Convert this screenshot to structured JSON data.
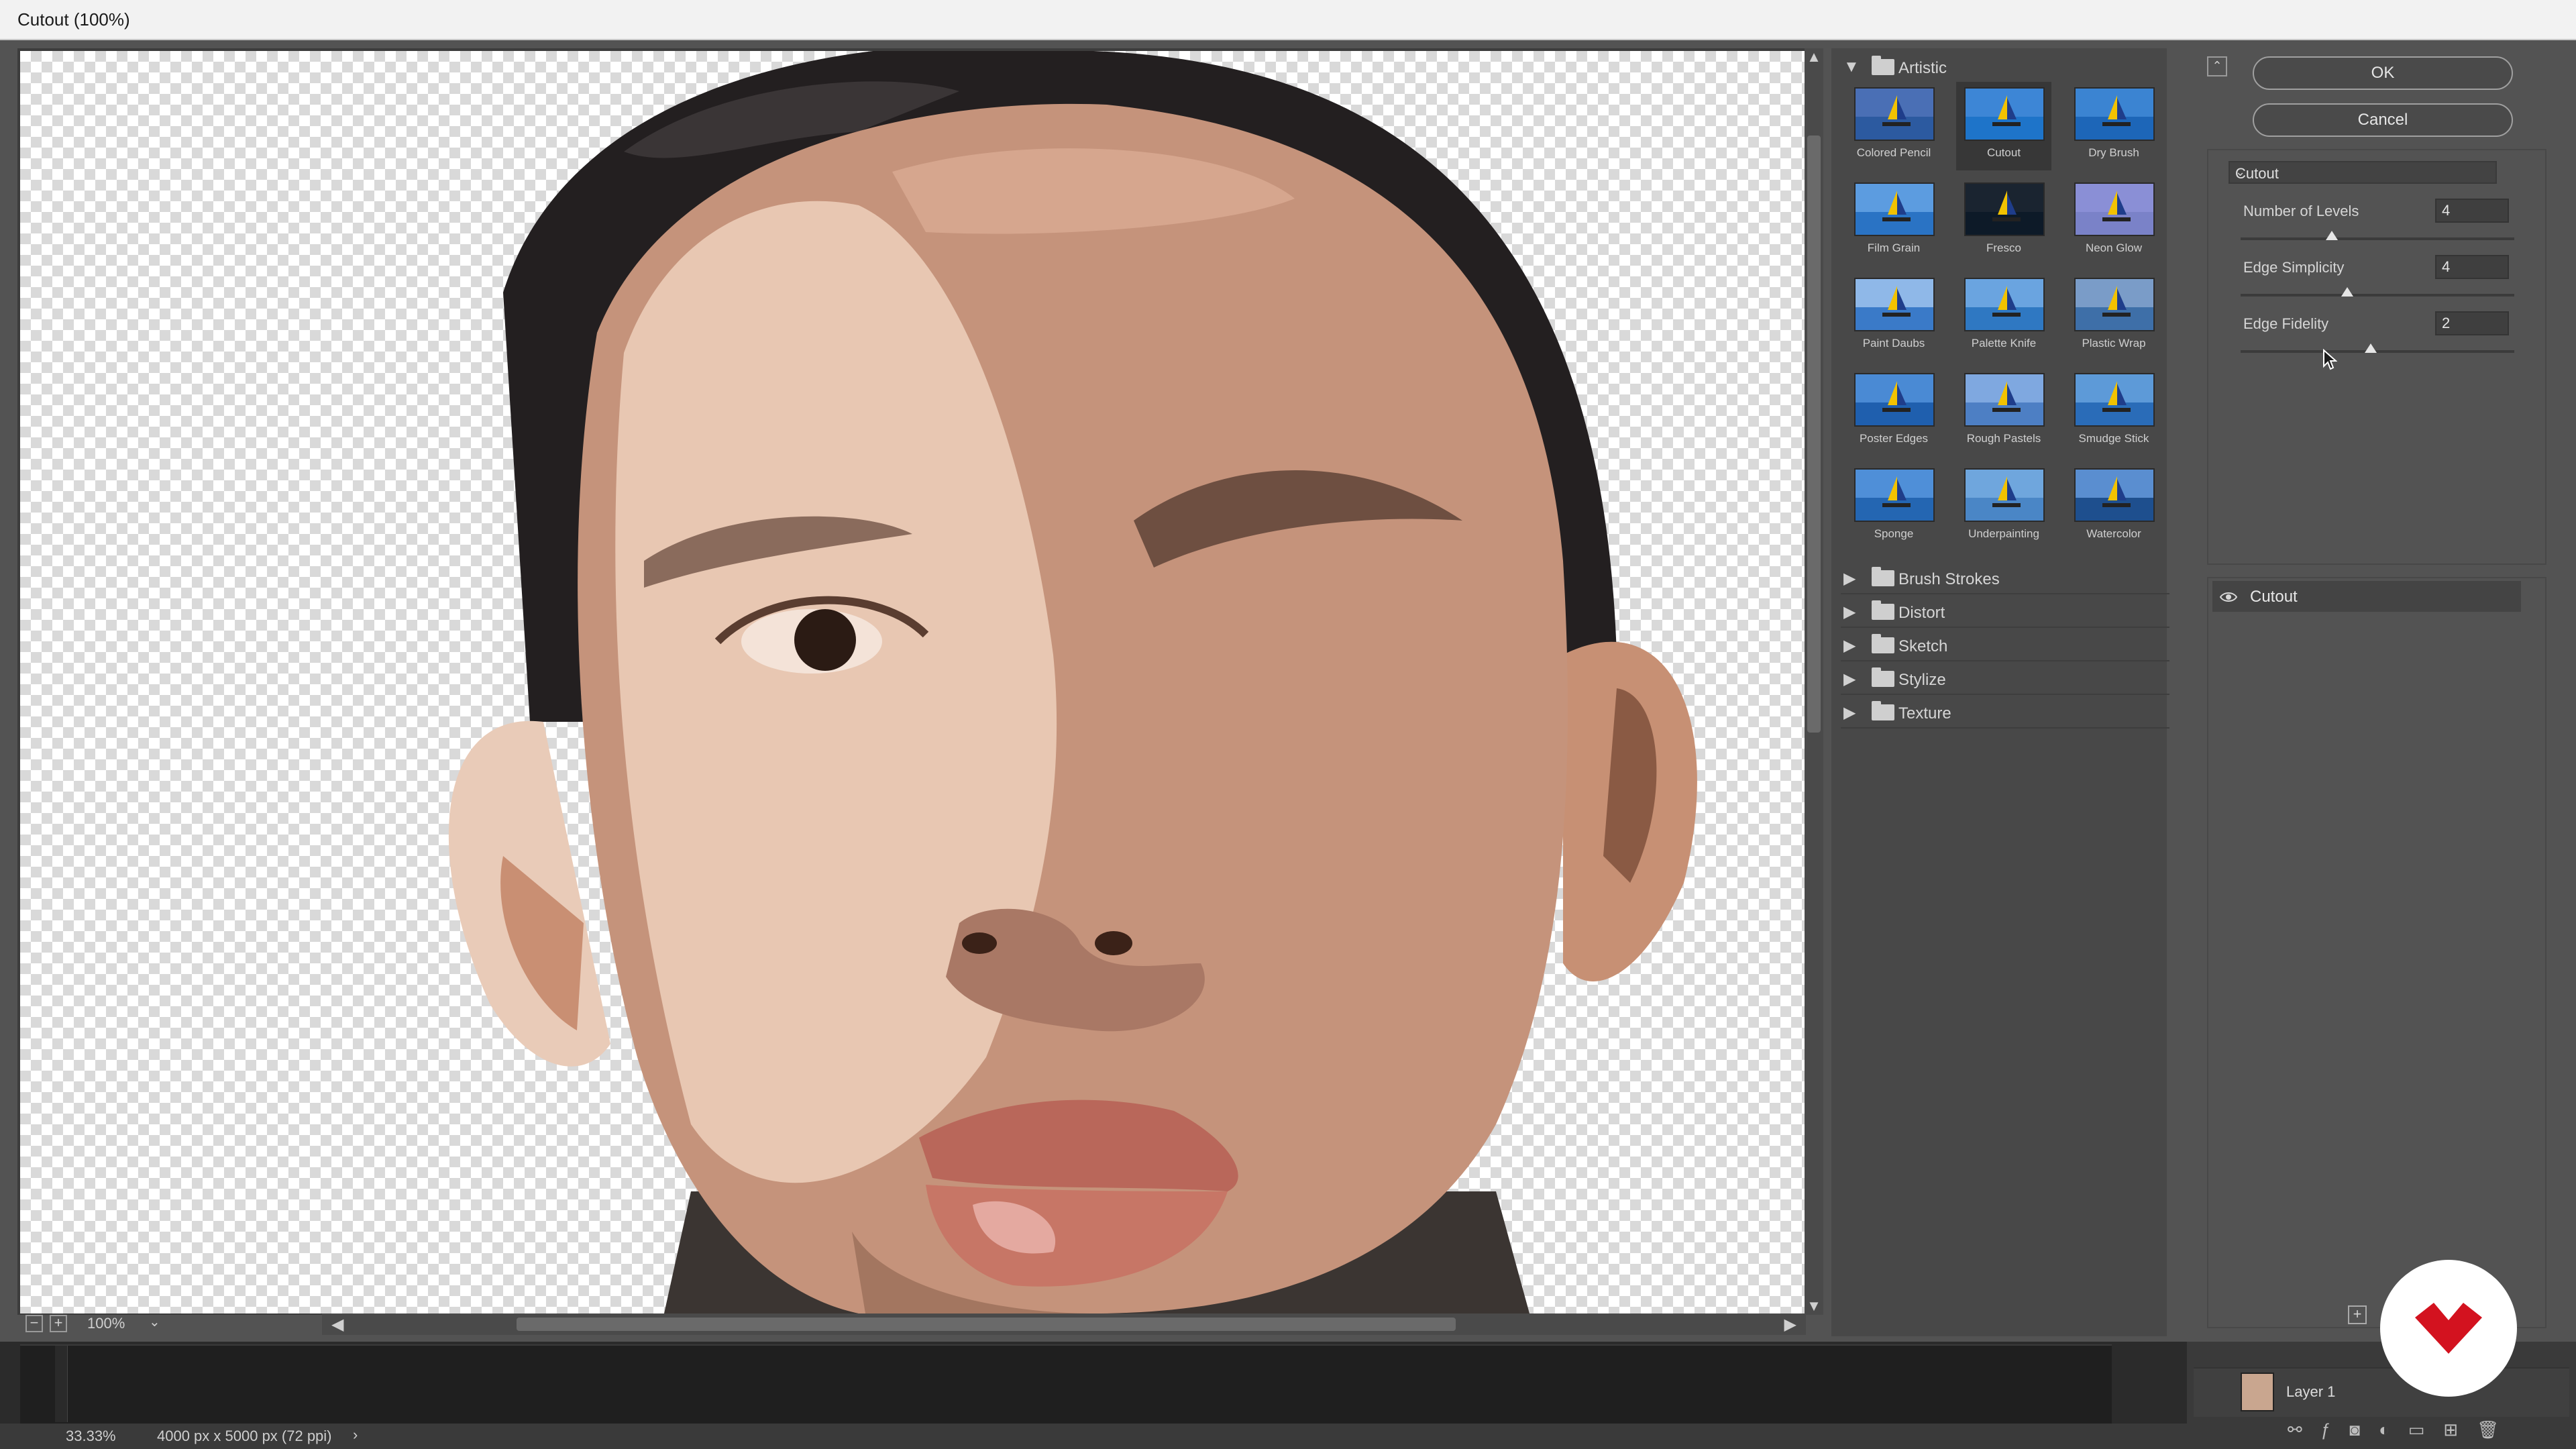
{
  "window": {
    "title": "Cutout (100%)"
  },
  "preview": {
    "zoom": "100%",
    "zoom_out_icon": "minus-square-icon",
    "zoom_in_icon": "plus-square-icon"
  },
  "gallery": {
    "open_folder": "Artistic",
    "filters": [
      {
        "name": "Colored Pencil",
        "selected": false,
        "sky": "#4a6fb5",
        "sea": "#2c5aa0"
      },
      {
        "name": "Cutout",
        "selected": true,
        "sky": "#3d86d6",
        "sea": "#1e74c9"
      },
      {
        "name": "Dry Brush",
        "selected": false,
        "sky": "#3b84d2",
        "sea": "#1d66b8"
      },
      {
        "name": "Film Grain",
        "selected": false,
        "sky": "#5c9ce0",
        "sea": "#2a73c4"
      },
      {
        "name": "Fresco",
        "selected": false,
        "sky": "#1a2430",
        "sea": "#0d1a28"
      },
      {
        "name": "Neon Glow",
        "selected": false,
        "sky": "#8a8fd6",
        "sea": "#7a82c8"
      },
      {
        "name": "Paint Daubs",
        "selected": false,
        "sky": "#8fb8e8",
        "sea": "#3a7ac8"
      },
      {
        "name": "Palette Knife",
        "selected": false,
        "sky": "#6aa4e0",
        "sea": "#2f78c2"
      },
      {
        "name": "Plastic Wrap",
        "selected": false,
        "sky": "#7a9cc8",
        "sea": "#3e6fa8"
      },
      {
        "name": "Poster Edges",
        "selected": false,
        "sky": "#4a8ad4",
        "sea": "#1f5fae"
      },
      {
        "name": "Rough Pastels",
        "selected": false,
        "sky": "#7fa8e0",
        "sea": "#4d7fc4"
      },
      {
        "name": "Smudge Stick",
        "selected": false,
        "sky": "#5d9ad8",
        "sea": "#2a6cb8"
      },
      {
        "name": "Sponge",
        "selected": false,
        "sky": "#4f8fd8",
        "sea": "#2466b2"
      },
      {
        "name": "Underpainting",
        "selected": false,
        "sky": "#6fa6dd",
        "sea": "#4a86c6"
      },
      {
        "name": "Watercolor",
        "selected": false,
        "sky": "#5a8ed0",
        "sea": "#1e4f8e"
      }
    ],
    "folders": [
      "Brush Strokes",
      "Distort",
      "Sketch",
      "Stylize",
      "Texture"
    ]
  },
  "settings": {
    "ok_label": "OK",
    "cancel_label": "Cancel",
    "filter_select": "Cutout",
    "params": [
      {
        "label": "Number of Levels",
        "value": "4",
        "min": 2,
        "max": 8
      },
      {
        "label": "Edge Simplicity",
        "value": "4",
        "min": 0,
        "max": 10
      },
      {
        "label": "Edge Fidelity",
        "value": "2",
        "min": 1,
        "max": 3
      }
    ],
    "effect_layer": "Cutout"
  },
  "status": {
    "zoom": "33.33%",
    "doc_info": "4000 px x 5000 px (72 ppi)"
  },
  "layers": {
    "layer1": "Layer 1"
  }
}
